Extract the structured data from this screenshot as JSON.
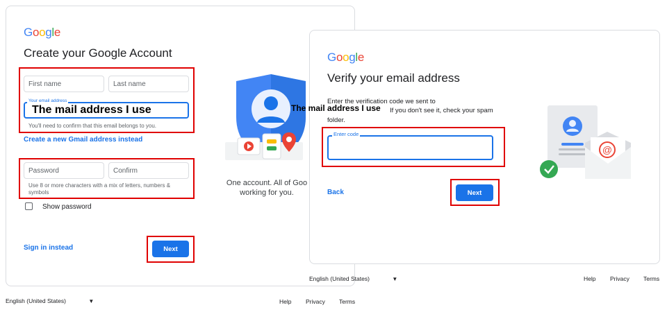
{
  "left": {
    "logo": "Google",
    "title": "Create your Google Account",
    "first_name_placeholder": "First name",
    "last_name_placeholder": "Last name",
    "email_label": "Your email address",
    "email_value": "The mail address I use",
    "email_hint": "You'll need to confirm that this email belongs to you.",
    "create_gmail_link": "Create a new Gmail address instead",
    "password_placeholder": "Password",
    "confirm_placeholder": "Confirm",
    "password_hint": "Use 8 or more characters with a mix of letters, numbers & symbols",
    "show_password_label": "Show password",
    "sign_in_link": "Sign in instead",
    "next_label": "Next",
    "caption_line1": "One account. All of Goo",
    "caption_line2": "working for you.",
    "footer": {
      "language": "English (United States)",
      "help": "Help",
      "privacy": "Privacy",
      "terms": "Terms"
    }
  },
  "right": {
    "logo": "Google",
    "title": "Verify your email address",
    "instructions_line1": "Enter the verification code we sent to",
    "instructions_line2_suffix": "If you don't see it, check your spam",
    "instructions_line3": "folder.",
    "email_overlay": "The mail address I use",
    "code_label": "Enter code",
    "back_link": "Back",
    "next_label": "Next",
    "footer": {
      "language": "English (United States)",
      "help": "Help",
      "privacy": "Privacy",
      "terms": "Terms"
    }
  },
  "colors": {
    "google_blue": "#4285F4",
    "google_red": "#EA4335",
    "google_yellow": "#FBBC05",
    "google_green": "#34A853",
    "button_blue": "#1a73e8",
    "annotation_red": "#e00000"
  }
}
